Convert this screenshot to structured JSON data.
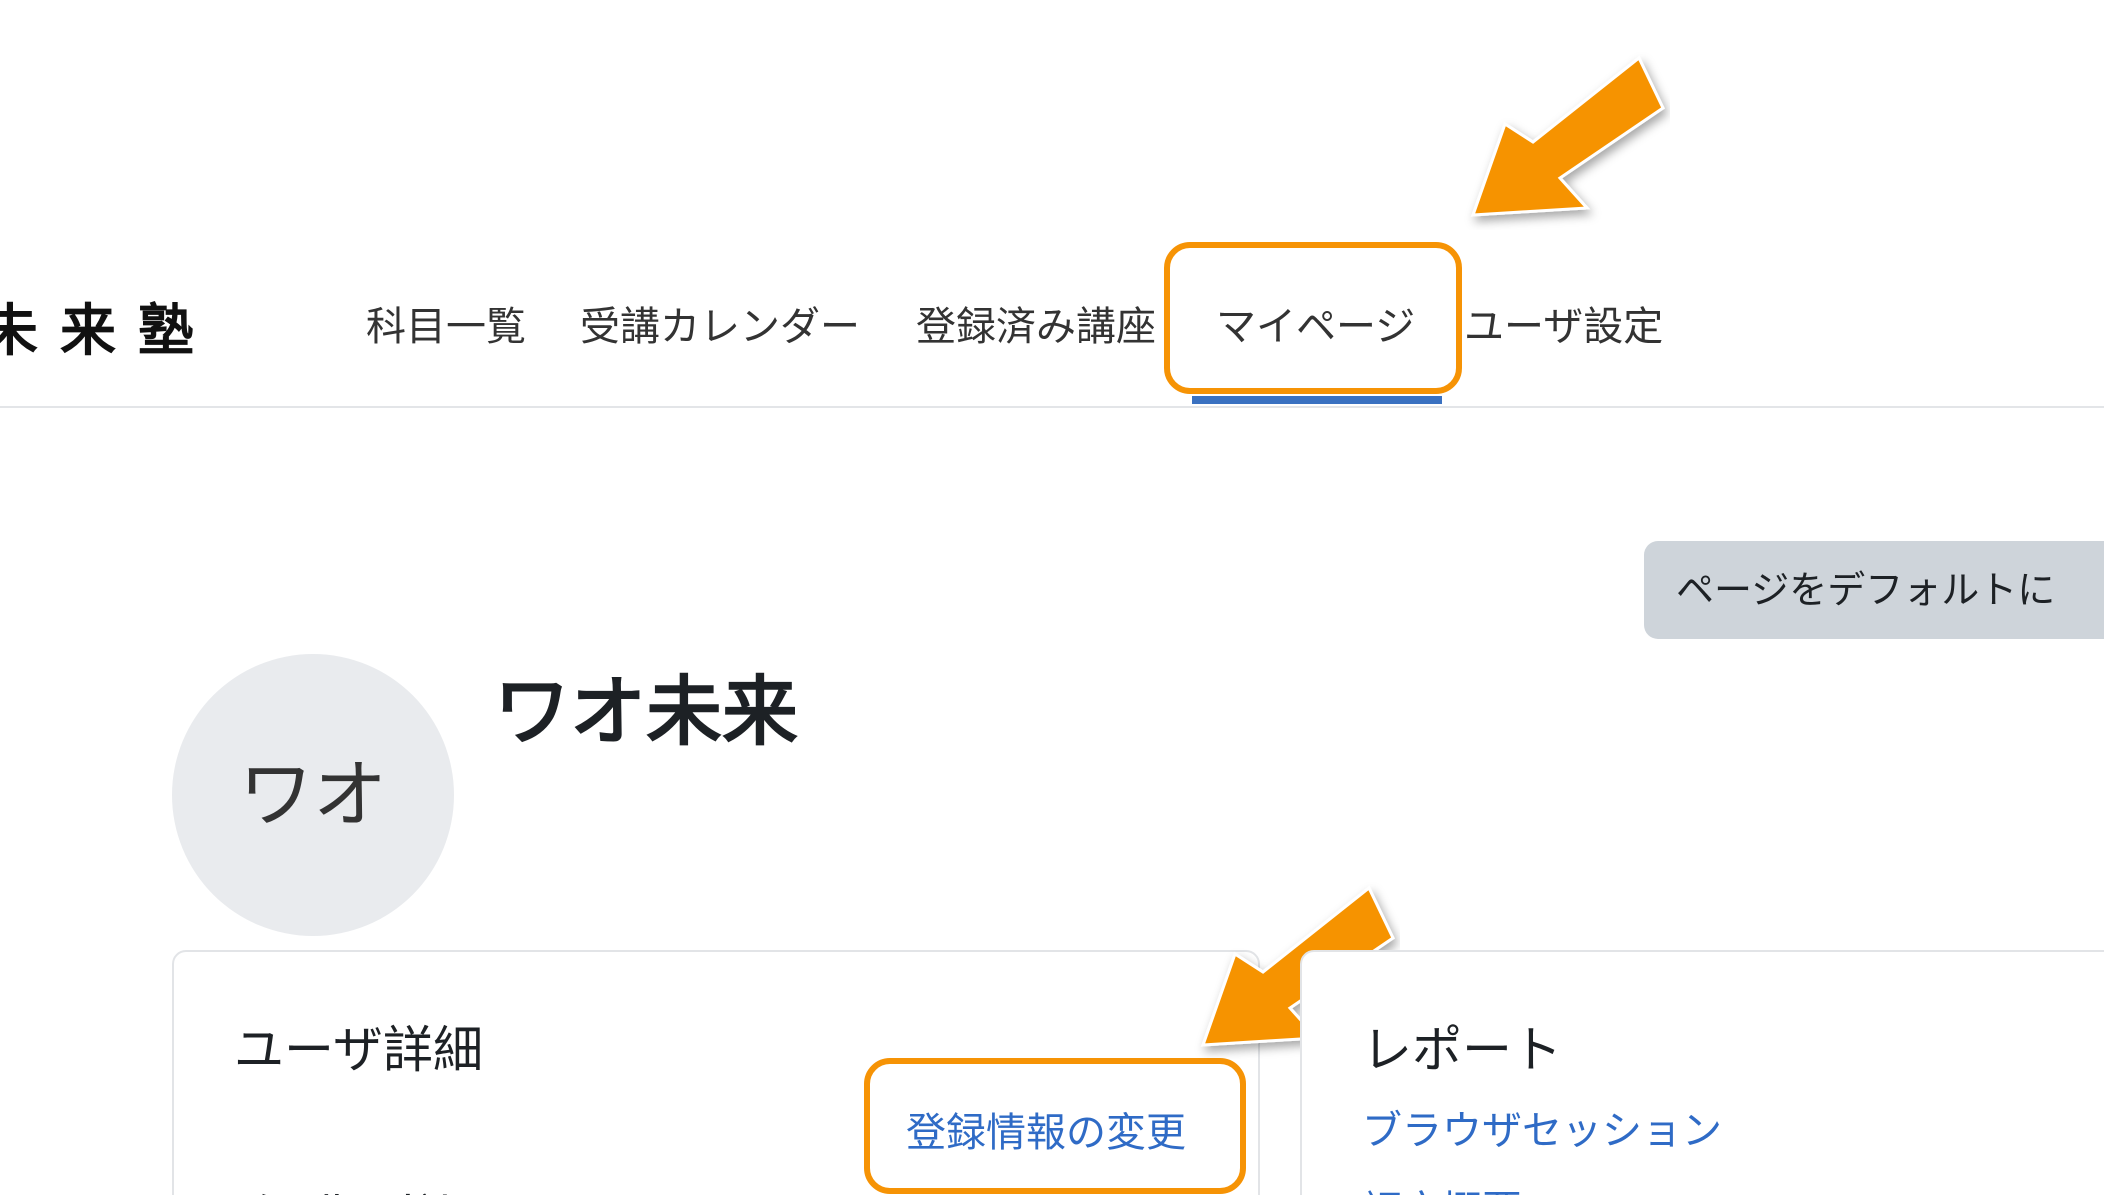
{
  "site": {
    "logo_text": "未来塾"
  },
  "nav": {
    "items": [
      {
        "label": "科目一覧"
      },
      {
        "label": "受講カレンダー"
      },
      {
        "label": "登録済み講座"
      },
      {
        "label": "マイページ",
        "active": true
      },
      {
        "label": "ユーザ設定"
      }
    ]
  },
  "page": {
    "reset_button_label": "ページをデフォルトに"
  },
  "profile": {
    "avatar_initials": "ワオ",
    "full_name": "ワオ未来"
  },
  "user_details": {
    "title": "ユーザ詳細",
    "edit_link_label": "登録情報の変更",
    "next_section_label_cut": "メールアドレス"
  },
  "reports": {
    "title": "レポート",
    "browser_sessions_link": "ブラウザセッション",
    "next_link_cut": "評定概要"
  },
  "colors": {
    "accent_orange": "#f69305",
    "link_blue": "#2f6bc6",
    "nav_active_underline": "#3a71c1",
    "button_gray": "#ced4da"
  }
}
